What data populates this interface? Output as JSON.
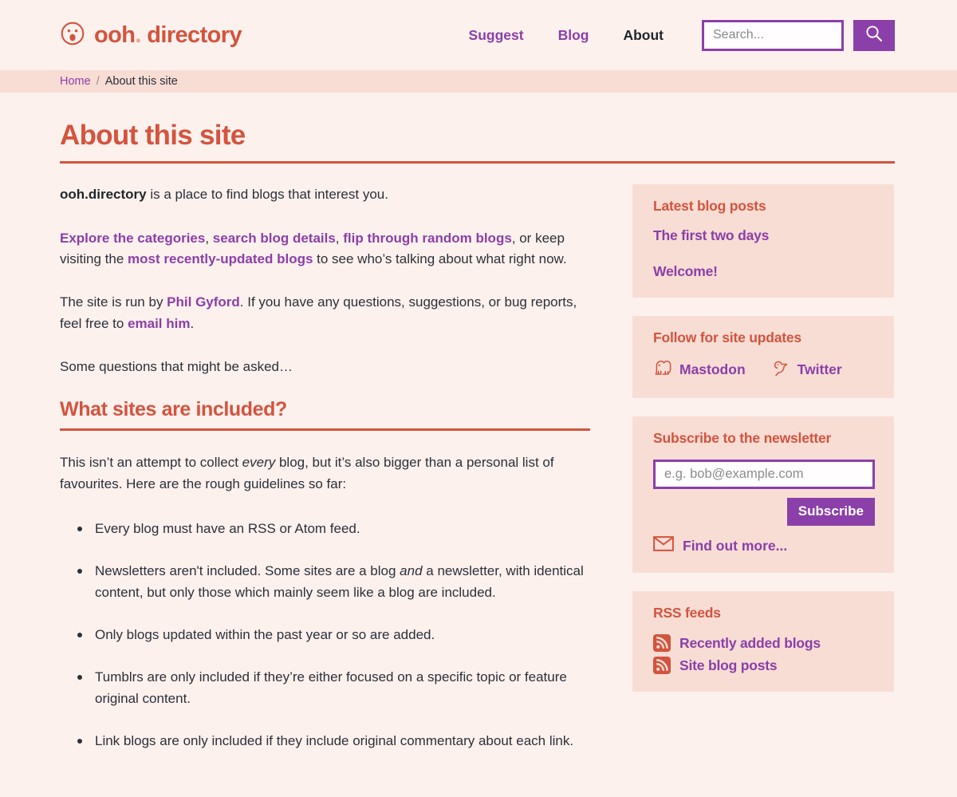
{
  "header": {
    "brand_name_prefix": "ooh",
    "brand_name_dot": ".",
    "brand_name_suffix": " directory",
    "brand_full": "ooh. directory",
    "logo_icon": "surprised-face-icon",
    "nav": [
      {
        "label": "Suggest",
        "current": false
      },
      {
        "label": "Blog",
        "current": false
      },
      {
        "label": "About",
        "current": true
      }
    ],
    "search": {
      "placeholder": "Search...",
      "value": "",
      "button_icon": "search-icon"
    }
  },
  "breadcrumb": {
    "home_label": "Home",
    "separator": "/",
    "current_label": "About this site"
  },
  "main": {
    "title": "About this site",
    "intro": {
      "bold_lead": "ooh.directory",
      "rest": " is a place to find blogs that interest you."
    },
    "links_para": {
      "link1": "Explore the categories",
      "sep1": ", ",
      "link2": "search blog details",
      "sep2": ", ",
      "link3": "flip through random blogs",
      "mid": ", or keep visiting the ",
      "link4": "most recently-updated blogs",
      "tail": " to see who’s talking about what right now."
    },
    "run_by_para": {
      "pre": "The site is run by ",
      "link1": "Phil Gyford",
      "mid": ". If you have any questions, suggestions, or bug reports, feel free to ",
      "link2": "email him",
      "tail": "."
    },
    "questions_para": "Some questions that might be asked…",
    "section_title": "What sites are included?",
    "section_intro": {
      "pre": "This isn’t an attempt to collect ",
      "em": "every",
      "post": " blog, but it’s also bigger than a personal list of favourites. Here are the rough guidelines so far:"
    },
    "guidelines": [
      {
        "text": "Every blog must have an RSS or Atom feed."
      },
      {
        "pre": "Newsletters aren't included. Some sites are a blog ",
        "em": "and",
        "post": " a newsletter, with identical content, but only those which mainly seem like a blog are included."
      },
      {
        "text": "Only blogs updated within the past year or so are added."
      },
      {
        "text": "Tumblrs are only included if they’re either focused on a specific topic or feature original content."
      },
      {
        "text": "Link blogs are only included if they include original commentary about each link."
      }
    ]
  },
  "aside": {
    "latest_posts": {
      "title": "Latest blog posts",
      "items": [
        {
          "label": "The first two days"
        },
        {
          "label": "Welcome!"
        }
      ]
    },
    "follow": {
      "title": "Follow for site updates",
      "items": [
        {
          "label": "Mastodon",
          "icon": "mastodon-icon"
        },
        {
          "label": "Twitter",
          "icon": "twitter-bird-icon"
        }
      ]
    },
    "newsletter": {
      "title": "Subscribe to the newsletter",
      "email_placeholder": "e.g. bob@example.com",
      "email_value": "",
      "submit_label": "Subscribe",
      "find_out_more": "Find out more...",
      "find_out_icon": "envelope-icon"
    },
    "rss": {
      "title": "RSS feeds",
      "items": [
        {
          "label": "Recently added blogs",
          "icon": "rss-icon"
        },
        {
          "label": "Site blog posts",
          "icon": "rss-icon"
        }
      ]
    }
  },
  "colors": {
    "page_bg": "#fdf1ee",
    "band_bg": "#f8ddd5",
    "brand_orange": "#d3543d",
    "link_purple": "#8b3fa8",
    "text_dark": "#2b3038"
  }
}
